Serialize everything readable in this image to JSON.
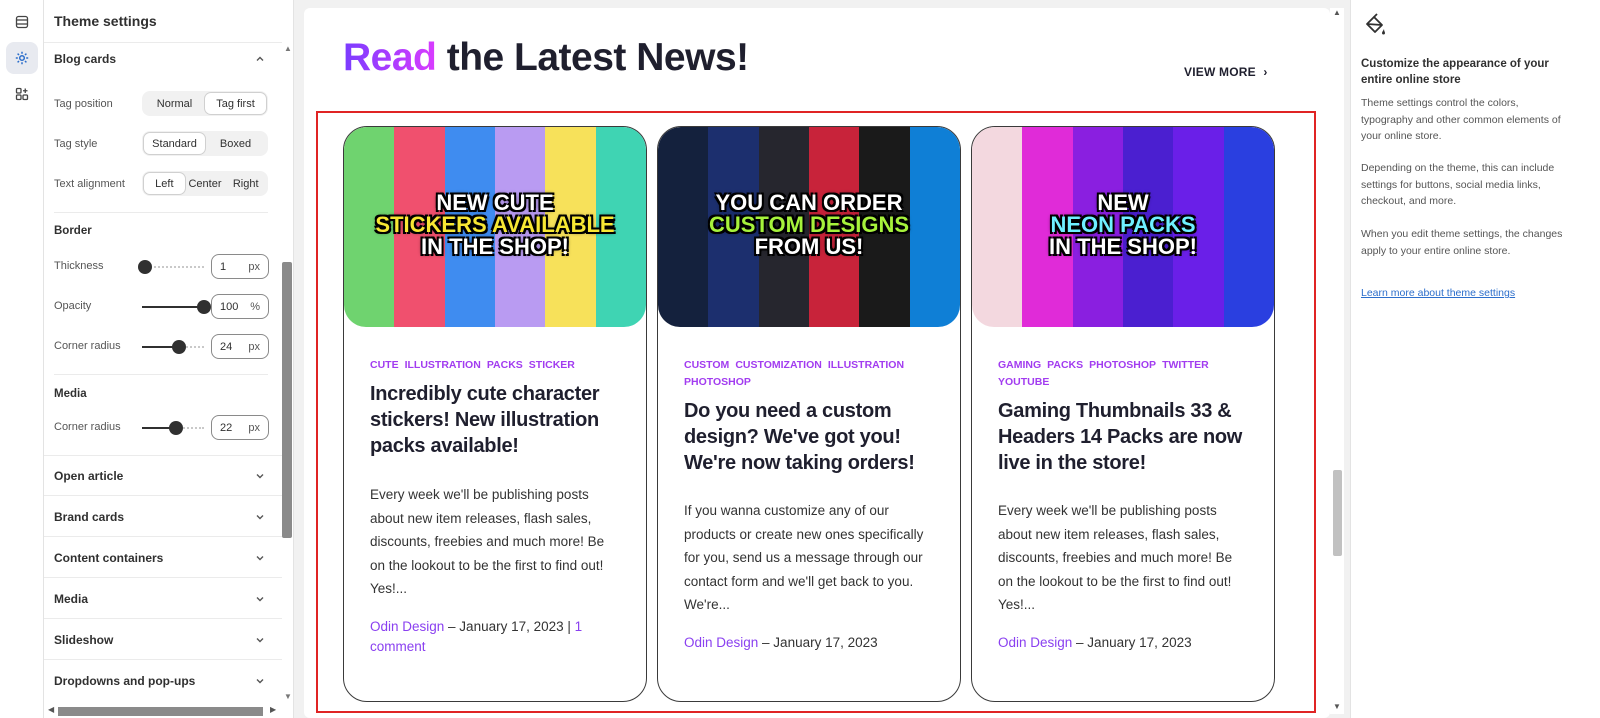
{
  "rail": {
    "items": [
      {
        "icon": "sections-icon"
      },
      {
        "icon": "gear-icon",
        "active": true
      },
      {
        "icon": "apps-icon"
      }
    ]
  },
  "panel": {
    "title": "Theme settings",
    "blog_cards": {
      "label": "Blog cards",
      "tag_position": {
        "label": "Tag position",
        "options": [
          "Normal",
          "Tag first"
        ],
        "selected": "Tag first"
      },
      "tag_style": {
        "label": "Tag style",
        "options": [
          "Standard",
          "Boxed"
        ],
        "selected": "Standard"
      },
      "text_alignment": {
        "label": "Text alignment",
        "options": [
          "Left",
          "Center",
          "Right"
        ],
        "selected": "Left"
      },
      "border": {
        "label": "Border",
        "thickness": {
          "label": "Thickness",
          "value": "1",
          "unit": "px",
          "level": 0.05
        },
        "opacity": {
          "label": "Opacity",
          "value": "100",
          "unit": "%",
          "level": 1.0
        },
        "corner_radius": {
          "label": "Corner radius",
          "value": "24",
          "unit": "px",
          "level": 0.6
        }
      },
      "media": {
        "label": "Media",
        "corner_radius": {
          "label": "Corner radius",
          "value": "22",
          "unit": "px",
          "level": 0.55
        }
      }
    },
    "sections": [
      "Open article",
      "Brand cards",
      "Content containers",
      "Media",
      "Slideshow",
      "Dropdowns and pop-ups"
    ]
  },
  "preview": {
    "heading_highlight": "Read",
    "heading_rest": " the Latest News!",
    "view_more": "VIEW MORE",
    "cards": [
      {
        "image_lines": [
          [
            "NEW CUTE",
            "w"
          ],
          [
            "STICKERS AVAILABLE",
            "y"
          ],
          [
            "IN THE SHOP!",
            "w"
          ]
        ],
        "tags": [
          "CUTE",
          "ILLUSTRATION",
          "PACKS",
          "STICKER"
        ],
        "title": "Incredibly cute character stickers! New illustration packs available!",
        "excerpt": "Every week we'll be publishing posts about new item releases, flash sales, discounts, freebies and much more! Be on the lookout to be the first to find out! Yes!...",
        "author": "Odin Design",
        "date": " – January 17, 2023 | ",
        "comments": "1 comment"
      },
      {
        "image_lines": [
          [
            "YOU CAN ORDER",
            "w"
          ],
          [
            "CUSTOM DESIGNS",
            "g"
          ],
          [
            "FROM US!",
            "w"
          ]
        ],
        "tags": [
          "CUSTOM",
          "CUSTOMIZATION",
          "ILLUSTRATION",
          "PHOTOSHOP"
        ],
        "title": "Do you need a custom design? We've got you! We're now taking orders!",
        "excerpt": "If you wanna customize any of our products or create new ones specifically for you, send us a message through our contact form and we'll get back to you. We're...",
        "author": "Odin Design",
        "date": " – January 17, 2023",
        "comments": ""
      },
      {
        "image_lines": [
          [
            "NEW",
            "w"
          ],
          [
            "NEON PACKS",
            "c"
          ],
          [
            "IN THE SHOP!",
            "w"
          ]
        ],
        "tags": [
          "GAMING",
          "PACKS",
          "PHOTOSHOP",
          "TWITTER",
          "YOUTUBE"
        ],
        "title": "Gaming Thumbnails 33 & Headers 14 Packs are now live in the store!",
        "excerpt": "Every week we'll be publishing posts about new item releases, flash sales, discounts, freebies and much more! Be on the lookout to be the first to find out! Yes!...",
        "author": "Odin Design",
        "date": " – January 17, 2023",
        "comments": ""
      }
    ]
  },
  "info": {
    "icon": "paint-bucket-icon",
    "title": "Customize the appearance of your entire online store",
    "p1": "Theme settings control the colors, typography and other common elements of your online store.",
    "p2": "Depending on the theme, this can include settings for buttons, social media links, checkout, and more.",
    "p3": "When you edit theme settings, the changes apply to your entire online store.",
    "link": "Learn more about theme settings"
  },
  "colors": {
    "accent_purple": "#8a40f0",
    "highlight_box": "#e02424"
  }
}
